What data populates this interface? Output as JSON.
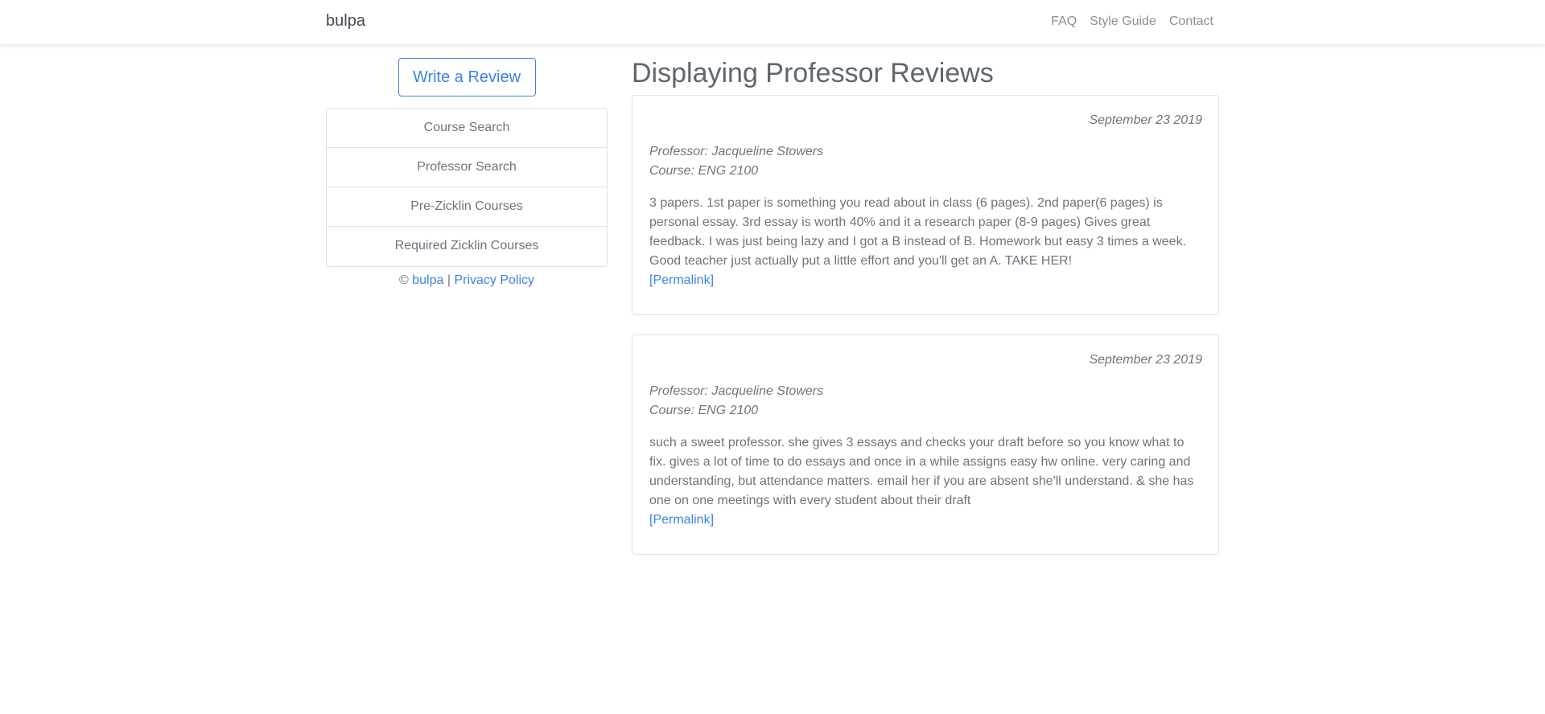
{
  "nav": {
    "brand": "bulpa",
    "links": [
      "FAQ",
      "Style Guide",
      "Contact"
    ]
  },
  "sidebar": {
    "write_review_label": "Write a Review",
    "items": [
      {
        "label": "Course Search"
      },
      {
        "label": "Professor Search"
      },
      {
        "label": "Pre-Zicklin Courses"
      },
      {
        "label": "Required Zicklin Courses"
      }
    ],
    "footer": {
      "copyright": "©",
      "brand_link": "bulpa",
      "separator": "|",
      "privacy_link": "Privacy Policy"
    }
  },
  "main": {
    "title": "Displaying Professor Reviews",
    "reviews": [
      {
        "date": "September 23 2019",
        "professor": "Professor: Jacqueline Stowers",
        "course": "Course: ENG 2100",
        "text": "3 papers. 1st paper is something you read about in class (6 pages). 2nd paper(6 pages) is personal essay. 3rd essay is worth 40% and it a research paper (8-9 pages) Gives great feedback. I was just being lazy and I got a B instead of B. Homework but easy 3 times a week. Good teacher just actually put a little effort and you'll get an A. TAKE HER!",
        "permalink": "[Permalink]"
      },
      {
        "date": "September 23 2019",
        "professor": "Professor: Jacqueline Stowers",
        "course": "Course: ENG 2100",
        "text": "such a sweet professor. she gives 3 essays and checks your draft before so you know what to fix. gives a lot of time to do essays and once in a while assigns easy hw online. very caring and understanding, but attendance matters. email her if you are absent she'll understand. & she has one on one meetings with every student about their draft",
        "permalink": "[Permalink]"
      }
    ]
  },
  "colors": {
    "accent": "#3b82e6",
    "text": "#6c757d",
    "border": "#dee2e6"
  }
}
